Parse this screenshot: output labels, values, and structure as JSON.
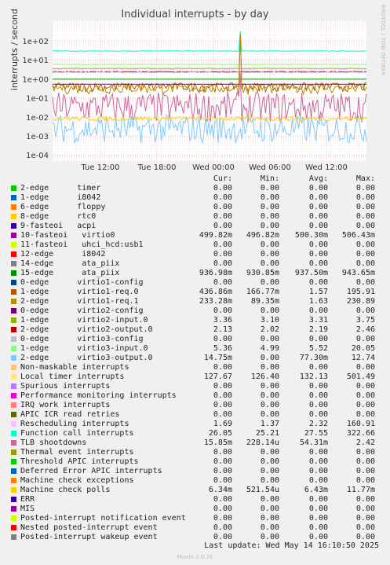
{
  "chart_data": {
    "type": "line",
    "title": "Individual interrupts - by day",
    "ylabel": "interrupts / second",
    "yscale": "log",
    "ylim": [
      5e-05,
      300
    ],
    "yticks": [
      "1e+02",
      "1e+01",
      "1e+00",
      "1e-01",
      "1e-02",
      "1e-03",
      "1e-04"
    ],
    "xticks": [
      "Tue 12:00",
      "Tue 18:00",
      "Wed 00:00",
      "Wed 06:00",
      "Wed 12:00"
    ],
    "grid": true,
    "columns": [
      "Cur:",
      "Min:",
      "Avg:",
      "Max:"
    ],
    "series": [
      {
        "name": "2-edge      timer",
        "color": "#00cc00",
        "cur": "0.00",
        "min": "0.00",
        "avg": "0.00",
        "max": "0.00"
      },
      {
        "name": "1-edge      i8042",
        "color": "#0066b3",
        "cur": "0.00",
        "min": "0.00",
        "avg": "0.00",
        "max": "0.00"
      },
      {
        "name": "6-edge      floppy",
        "color": "#ff8000",
        "cur": "0.00",
        "min": "0.00",
        "avg": "0.00",
        "max": "0.00"
      },
      {
        "name": "8-edge      rtc0",
        "color": "#ffcc00",
        "cur": "0.00",
        "min": "0.00",
        "avg": "0.00",
        "max": "0.00"
      },
      {
        "name": "9-fasteoi   acpi",
        "color": "#330099",
        "cur": "0.00",
        "min": "0.00",
        "avg": "0.00",
        "max": "0.00"
      },
      {
        "name": "10-fasteoi   virtio0",
        "color": "#990099",
        "cur": "499.82m",
        "min": "496.82m",
        "avg": "500.30m",
        "max": "506.43m"
      },
      {
        "name": "11-fasteoi   uhci_hcd:usb1",
        "color": "#ccff00",
        "cur": "0.00",
        "min": "0.00",
        "avg": "0.00",
        "max": "0.00"
      },
      {
        "name": "12-edge      i8042",
        "color": "#ff0000",
        "cur": "0.00",
        "min": "0.00",
        "avg": "0.00",
        "max": "0.00"
      },
      {
        "name": "14-edge      ata_piix",
        "color": "#808080",
        "cur": "0.00",
        "min": "0.00",
        "avg": "0.00",
        "max": "0.00"
      },
      {
        "name": "15-edge      ata_piix",
        "color": "#008f00",
        "cur": "936.98m",
        "min": "930.85m",
        "avg": "937.50m",
        "max": "943.65m"
      },
      {
        "name": "0-edge      virtio1-config",
        "color": "#00487d",
        "cur": "0.00",
        "min": "0.00",
        "avg": "0.00",
        "max": "0.00"
      },
      {
        "name": "1-edge      virtio1-req.0",
        "color": "#b35a00",
        "cur": "436.86m",
        "min": "166.77m",
        "avg": "1.57",
        "max": "195.91"
      },
      {
        "name": "2-edge      virtio1-req.1",
        "color": "#b38f00",
        "cur": "233.28m",
        "min": "89.35m",
        "avg": "1.63",
        "max": "230.89"
      },
      {
        "name": "0-edge      virtio2-config",
        "color": "#6b006b",
        "cur": "0.00",
        "min": "0.00",
        "avg": "0.00",
        "max": "0.00"
      },
      {
        "name": "1-edge      virtio2-input.0",
        "color": "#8fb300",
        "cur": "3.36",
        "min": "3.10",
        "avg": "3.31",
        "max": "3.75"
      },
      {
        "name": "2-edge      virtio2-output.0",
        "color": "#b30000",
        "cur": "2.13",
        "min": "2.02",
        "avg": "2.19",
        "max": "2.46"
      },
      {
        "name": "0-edge      virtio3-config",
        "color": "#bebebe",
        "cur": "0.00",
        "min": "0.00",
        "avg": "0.00",
        "max": "0.00"
      },
      {
        "name": "1-edge      virtio3-input.0",
        "color": "#80ff80",
        "cur": "5.36",
        "min": "4.99",
        "avg": "5.52",
        "max": "20.05"
      },
      {
        "name": "2-edge      virtio3-output.0",
        "color": "#80c9ff",
        "cur": "14.75m",
        "min": "0.00",
        "avg": "77.30m",
        "max": "12.74"
      },
      {
        "name": "Non-maskable interrupts",
        "color": "#ffc080",
        "cur": "0.00",
        "min": "0.00",
        "avg": "0.00",
        "max": "0.00"
      },
      {
        "name": "Local timer interrupts",
        "color": "#ffe680",
        "cur": "127.67",
        "min": "126.40",
        "avg": "132.13",
        "max": "501.49"
      },
      {
        "name": "Spurious interrupts",
        "color": "#aa80ff",
        "cur": "0.00",
        "min": "0.00",
        "avg": "0.00",
        "max": "0.00"
      },
      {
        "name": "Performance monitoring interrupts",
        "color": "#ee00cc",
        "cur": "0.00",
        "min": "0.00",
        "avg": "0.00",
        "max": "0.00"
      },
      {
        "name": "IRQ work interrupts",
        "color": "#ff8080",
        "cur": "0.00",
        "min": "0.00",
        "avg": "0.00",
        "max": "0.00"
      },
      {
        "name": "APIC ICR read retries",
        "color": "#666600",
        "cur": "0.00",
        "min": "0.00",
        "avg": "0.00",
        "max": "0.00"
      },
      {
        "name": "Rescheduling interrupts",
        "color": "#ffbfff",
        "cur": "1.69",
        "min": "1.37",
        "avg": "2.32",
        "max": "160.91"
      },
      {
        "name": "Function call interrupts",
        "color": "#00ffcc",
        "cur": "26.05",
        "min": "25.21",
        "avg": "27.55",
        "max": "322.66"
      },
      {
        "name": "TLB shootdowns",
        "color": "#cc6699",
        "cur": "15.85m",
        "min": "228.14u",
        "avg": "54.31m",
        "max": "2.42"
      },
      {
        "name": "Thermal event interrupts",
        "color": "#999900",
        "cur": "0.00",
        "min": "0.00",
        "avg": "0.00",
        "max": "0.00"
      },
      {
        "name": "Threshold APIC interrupts",
        "color": "#00cc00",
        "cur": "0.00",
        "min": "0.00",
        "avg": "0.00",
        "max": "0.00"
      },
      {
        "name": "Deferred Error APIC interrupts",
        "color": "#0066b3",
        "cur": "0.00",
        "min": "0.00",
        "avg": "0.00",
        "max": "0.00"
      },
      {
        "name": "Machine check exceptions",
        "color": "#ff8000",
        "cur": "0.00",
        "min": "0.00",
        "avg": "0.00",
        "max": "0.00"
      },
      {
        "name": "Machine check polls",
        "color": "#ffcc00",
        "cur": "6.34m",
        "min": "521.54u",
        "avg": "6.43m",
        "max": "11.77m"
      },
      {
        "name": "ERR",
        "color": "#330099",
        "cur": "0.00",
        "min": "0.00",
        "avg": "0.00",
        "max": "0.00"
      },
      {
        "name": "MIS",
        "color": "#990099",
        "cur": "0.00",
        "min": "0.00",
        "avg": "0.00",
        "max": "0.00"
      },
      {
        "name": "Posted-interrupt notification event",
        "color": "#ccff00",
        "cur": "0.00",
        "min": "0.00",
        "avg": "0.00",
        "max": "0.00"
      },
      {
        "name": "Nested posted-interrupt event",
        "color": "#ff0000",
        "cur": "0.00",
        "min": "0.00",
        "avg": "0.00",
        "max": "0.00"
      },
      {
        "name": "Posted-interrupt wakeup event",
        "color": "#808080",
        "cur": "0.00",
        "min": "0.00",
        "avg": "0.00",
        "max": "0.00"
      }
    ]
  },
  "side_text": "RRDTOOL / TOBI OETIKER",
  "footer": "Last update: Wed May 14 16:10:50 2025",
  "munin": "Munin 2.0.76"
}
